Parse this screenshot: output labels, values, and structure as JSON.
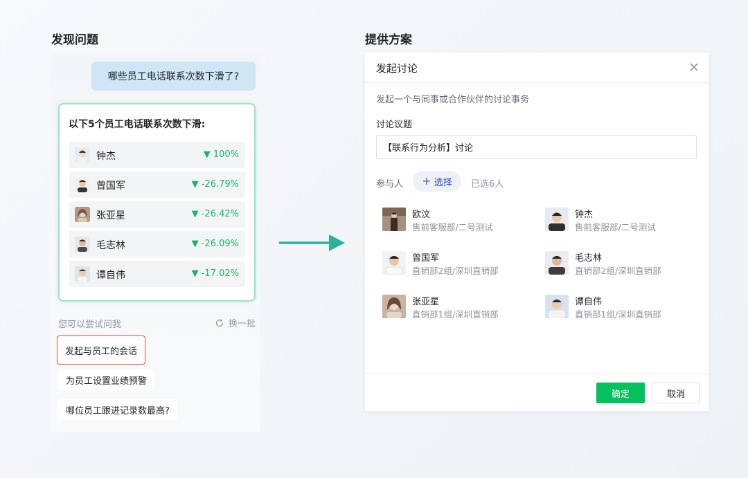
{
  "left": {
    "section_title": "发现问题",
    "question": "哪些员工电话联系次数下滑了?",
    "result": {
      "title": "以下5个员工电话联系次数下滑:",
      "employees": [
        {
          "name": "钟杰",
          "change": "▼ 100%"
        },
        {
          "name": "曾国军",
          "change": "▼ -26.79%"
        },
        {
          "name": "张亚星",
          "change": "▼ -26.42%"
        },
        {
          "name": "毛志林",
          "change": "▼ -26.09%"
        },
        {
          "name": "谭自伟",
          "change": "▼ -17.02%"
        }
      ],
      "change_color": "#18b566"
    },
    "suggest_label": "您可以尝试问我",
    "refresh_label": "换一批",
    "suggestions": [
      "发起与员工的会话",
      "为员工设置业绩预警",
      "哪位员工跟进记录数最高?"
    ]
  },
  "right": {
    "section_title": "提供方案",
    "dialog": {
      "title": "发起讨论",
      "description": "发起一个与同事或合作伙伴的讨论事务",
      "topic_label": "讨论议题",
      "topic_value": "【联系行为分析】讨论",
      "participants_label": "参与人",
      "select_label": "选择",
      "selected_count": "已选6人",
      "members": [
        {
          "name": "欧汶",
          "dept": "售前客服部/二号测试"
        },
        {
          "name": "钟杰",
          "dept": "售前客服部/二号测试"
        },
        {
          "name": "曾国军",
          "dept": "直销部2组/深圳直销部"
        },
        {
          "name": "毛志林",
          "dept": "直销部2组/深圳直销部"
        },
        {
          "name": "张亚星",
          "dept": "直销部1组/深圳直销部"
        },
        {
          "name": "谭自伟",
          "dept": "直销部1组/深圳直销部"
        }
      ],
      "confirm_label": "确定",
      "cancel_label": "取消"
    }
  },
  "colors": {
    "accent_green": "#07c160",
    "arrow_teal": "#2bb39a",
    "highlight_red": "#e24a3b",
    "question_bubble": "#cfe6f6"
  }
}
